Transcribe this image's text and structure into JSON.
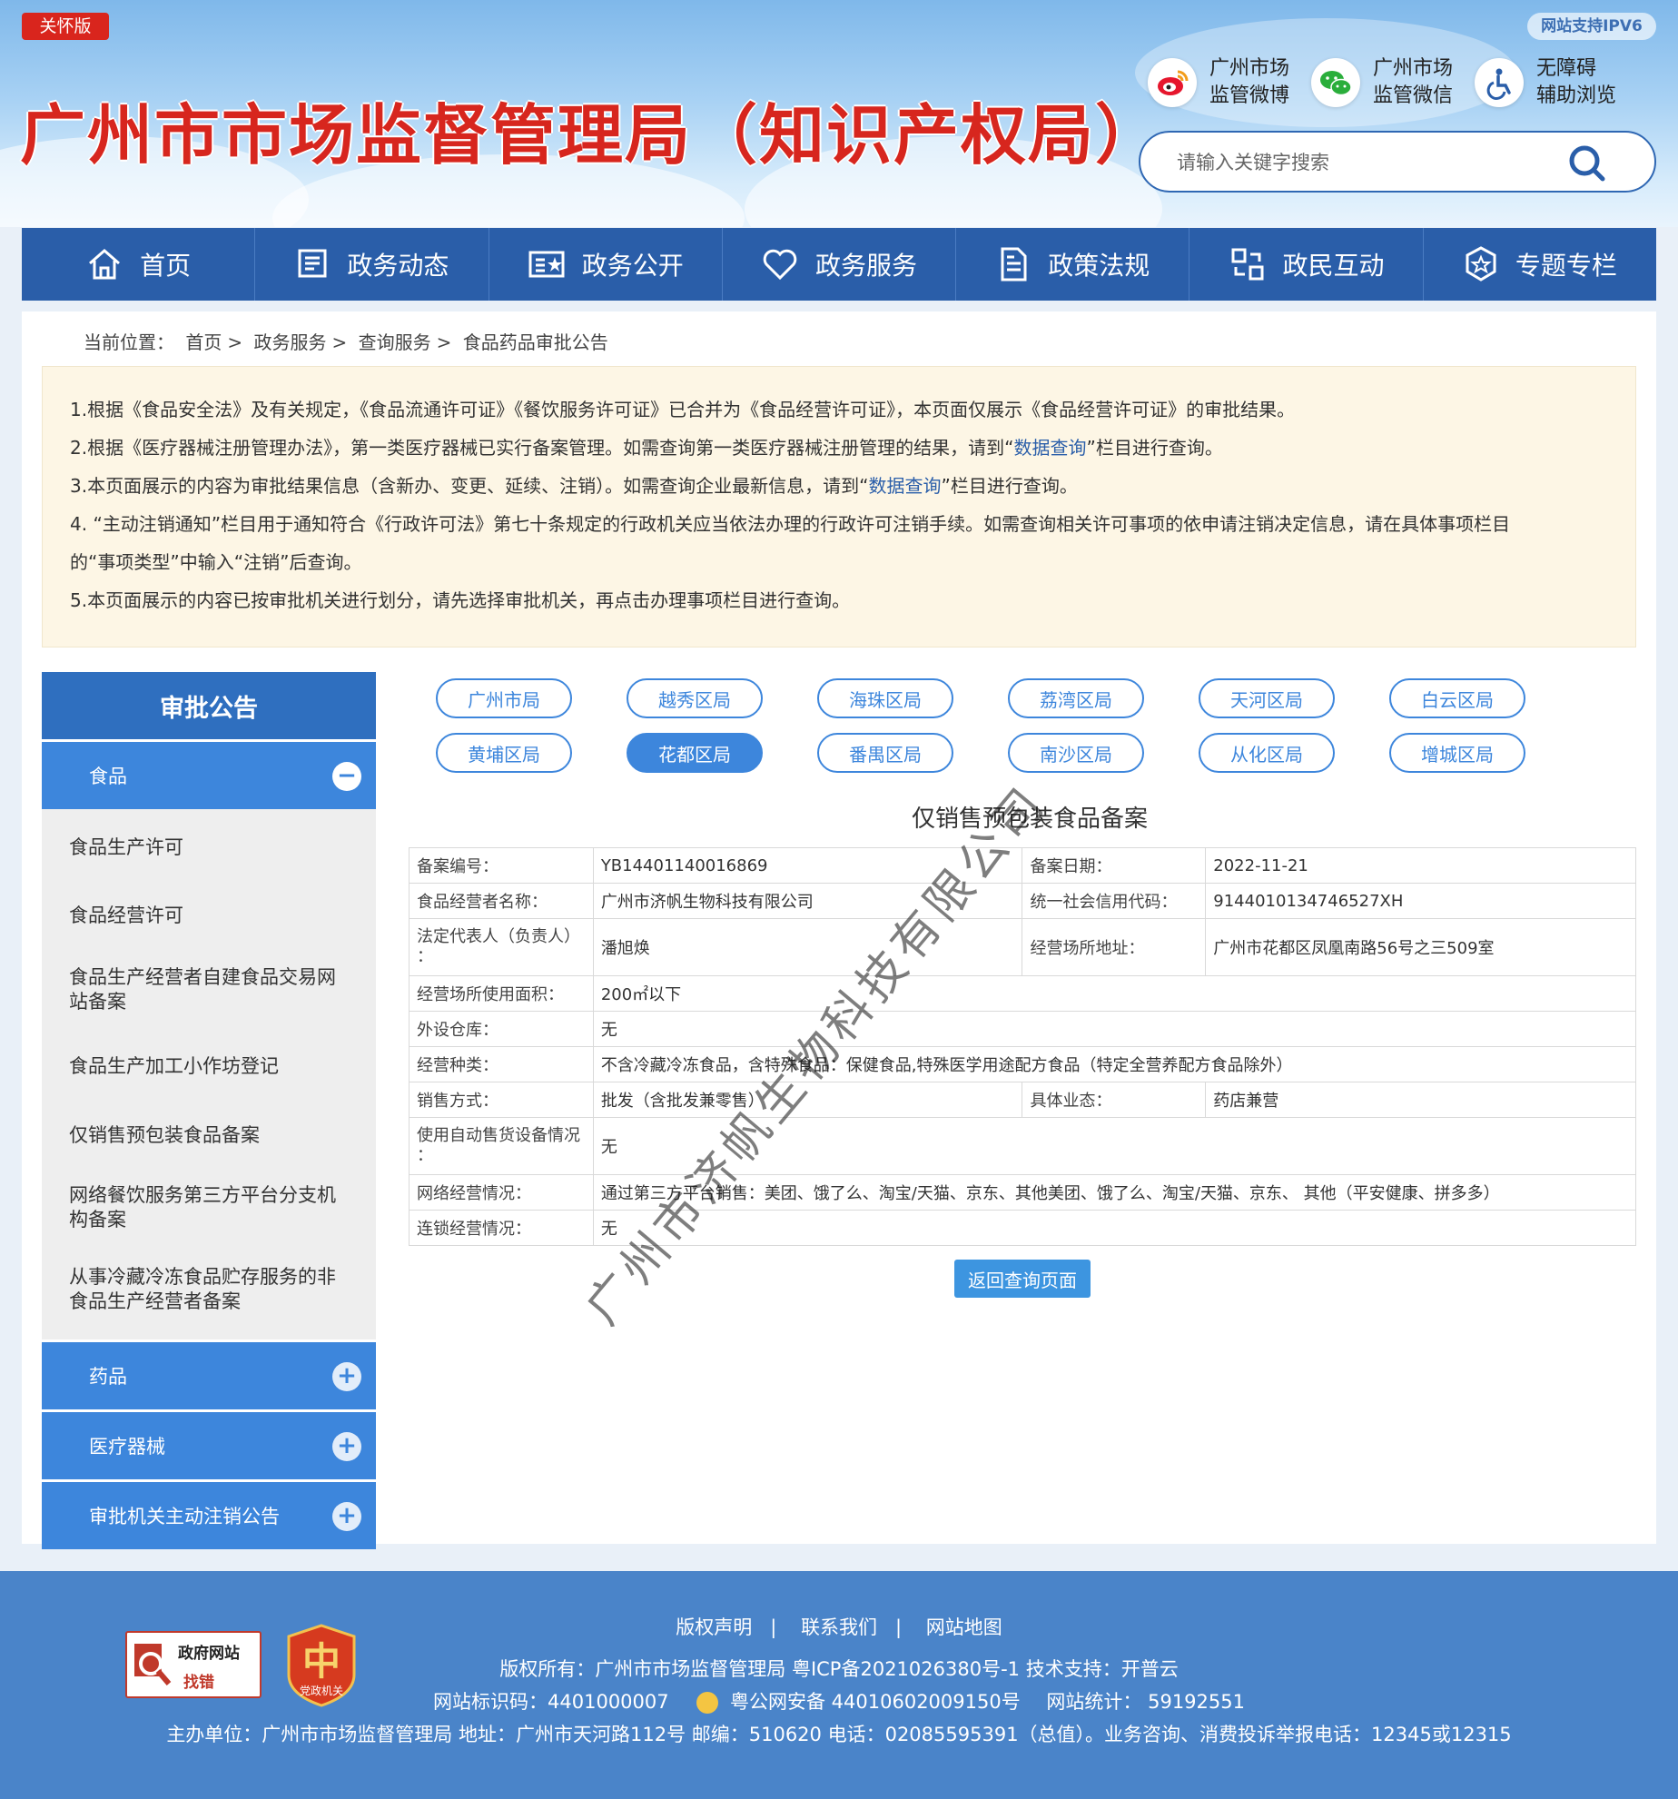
{
  "header": {
    "care_badge": "关怀版",
    "ipv6_badge": "网站支持IPV6",
    "site_title": "广州市市场监督管理局（知识产权局）",
    "quick_links": [
      {
        "icon": "weibo-icon",
        "line1": "广州市场",
        "line2": "监管微博"
      },
      {
        "icon": "wechat-icon",
        "line1": "广州市场",
        "line2": "监管微信"
      },
      {
        "icon": "accessibility-icon",
        "line1": "无障碍",
        "line2": "辅助浏览"
      }
    ],
    "search": {
      "placeholder": "请输入关键字搜索",
      "icon": "search-icon"
    }
  },
  "nav": [
    {
      "label": "首页",
      "icon": "home-icon"
    },
    {
      "label": "政务动态",
      "icon": "news-icon"
    },
    {
      "label": "政务公开",
      "icon": "public-card-icon"
    },
    {
      "label": "政务服务",
      "icon": "heart-icon"
    },
    {
      "label": "政策法规",
      "icon": "document-icon"
    },
    {
      "label": "政民互动",
      "icon": "interact-icon"
    },
    {
      "label": "专题专栏",
      "icon": "star-badge-icon"
    }
  ],
  "breadcrumb": {
    "prefix": "当前位置：",
    "items": [
      "首页",
      "政务服务",
      "查询服务",
      "食品药品审批公告"
    ],
    "sep": ">"
  },
  "notice": {
    "l1": "1.根据《食品安全法》及有关规定，《食品流通许可证》《餐饮服务许可证》已合并为《食品经营许可证》，本页面仅展示《食品经营许可证》的审批结果。",
    "l2a": "2.根据《医疗器械注册管理办法》，第一类医疗器械已实行备案管理。如需查询第一类医疗器械注册管理的结果，请到“",
    "l2link": "数据查询",
    "l2b": "”栏目进行查询。",
    "l3a": "3.本页面展示的内容为审批结果信息（含新办、变更、延续、注销）。如需查询企业最新信息，请到“",
    "l3link": "数据查询",
    "l3b": "”栏目进行查询。",
    "l4": "4. “主动注销通知”栏目用于通知符合《行政许可法》第七十条规定的行政机关应当依法办理的行政许可注销手续。如需查询相关许可事项的依申请注销决定信息，请在具体事项栏目",
    "l4b": "的“事项类型”中输入“注销”后查询。",
    "l5": "5.本页面展示的内容已按审批机关进行划分，请先选择审批机关，再点击办理事项栏目进行查询。"
  },
  "sidebar": {
    "title": "审批公告",
    "categories": [
      {
        "label": "食品",
        "toggle": "−"
      },
      {
        "label": "药品",
        "toggle": "+"
      },
      {
        "label": "医疗器械",
        "toggle": "+"
      },
      {
        "label": "审批机关主动注销公告",
        "toggle": "+"
      }
    ],
    "food_items": [
      "食品生产许可",
      "食品经营许可",
      "食品生产经营者自建食品交易网站备案",
      "食品生产加工小作坊登记",
      "仅销售预包装食品备案",
      "网络餐饮服务第三方平台分支机构备案",
      "从事冷藏冷冻食品贮存服务的非食品生产经营者备案"
    ]
  },
  "regions": {
    "items": [
      "广州市局",
      "越秀区局",
      "海珠区局",
      "荔湾区局",
      "天河区局",
      "白云区局",
      "黄埔区局",
      "花都区局",
      "番禺区局",
      "南沙区局",
      "从化区局",
      "增城区局"
    ],
    "active": "花都区局"
  },
  "record": {
    "title": "仅销售预包装食品备案",
    "rows": {
      "filing_no_label": "备案编号：",
      "filing_no": "YB14401140016869",
      "filing_date_label": "备案日期：",
      "filing_date": "2022-11-21",
      "operator_label": "食品经营者名称：",
      "operator": "广州市济帆生物科技有限公司",
      "credit_label": "统一社会信用代码：",
      "credit": "9144010134746527XH",
      "legal_label_1": "法定代表人（负责人）",
      "legal_label_2": "：",
      "legal": "潘旭焕",
      "address_label": "经营场所地址：",
      "address": "广州市花都区凤凰南路56号之三509室",
      "area_label": "经营场所使用面积：",
      "area": "200㎡以下",
      "warehouse_label": "外设仓库：",
      "warehouse": "无",
      "category_label": "经营种类：",
      "category": "不含冷藏冷冻食品，含特殊食品：保健食品,特殊医学用途配方食品（特定全营养配方食品除外）",
      "sales_label": "销售方式：",
      "sales": "批发（含批发兼零售）",
      "business_label": "具体业态：",
      "business": "药店兼营",
      "vending_label_1": "使用自动售货设备情况",
      "vending_label_2": "：",
      "vending": "无",
      "online_label": "网络经营情况：",
      "online": "通过第三方平台销售：美团、饿了么、淘宝/天猫、京东、其他美团、饿了么、淘宝/天猫、京东、 其他（平安健康、拼多多）",
      "chain_label": "连锁经营情况：",
      "chain": "无"
    },
    "back_button": "返回查询页面",
    "watermark": "广州市济帆生物科技有限公司"
  },
  "footer": {
    "links": [
      "版权声明",
      "联系我们",
      "网站地图"
    ],
    "sep": "|",
    "copyright": "版权所有：广州市市场监督管理局     粤ICP备2021026380号-1 技术支持：开普云",
    "site_id": "网站标识码：4401000007",
    "police": "粤公网安备 44010602009150号",
    "stats": "网站统计： 59192551",
    "host": "主办单位：广州市市场监督管理局 地址：广州市天河路112号 邮编：510620 电话：02085595391（总值）。业务咨询、消费投诉举报电话：12345或12315",
    "jiucuo_1": "政府网站",
    "jiucuo_2": "找错",
    "dangzheng": "党政机关"
  },
  "colors": {
    "nav_bg": "#2a5ea9",
    "accent": "#3d86dc",
    "title_red": "#d7261e",
    "footer_bg": "#4a84c9"
  }
}
